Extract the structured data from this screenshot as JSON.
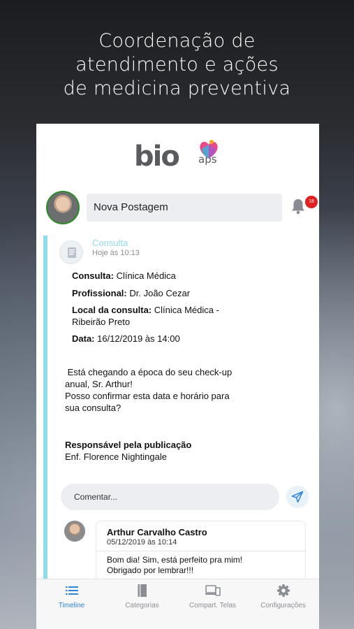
{
  "headline": {
    "line1": "Coordenação de",
    "line2": "atendimento e ações",
    "line3": "de medicina preventiva"
  },
  "app": {
    "logo_text": "bio",
    "logo_sub": "aps",
    "brand_colors": [
      "#e84a8a",
      "#3bb4d8",
      "#f5a623"
    ]
  },
  "compose": {
    "new_post_label": "Nova Postagem",
    "notification_count": "18"
  },
  "post": {
    "type": "Consulta",
    "time": "Hoje às 10:13",
    "accent_color": "#8fdcef",
    "details": [
      {
        "label": "Consulta:",
        "value": " Clínica Médica"
      },
      {
        "label": "Profissional:",
        "value": " Dr. João Cezar"
      },
      {
        "label": "Local da consulta:",
        "value": " Clínica Médica -"
      },
      {
        "label": "",
        "value": "Ribeirão Preto"
      },
      {
        "label": "Data:",
        "value": " 16/12/2019 às 14:00"
      }
    ],
    "body_line1": " Está chegando a época do seu check-up",
    "body_line2": "anual, Sr. Arthur!",
    "body_line3": "Posso confirmar esta data e horário para",
    "body_line4": "sua consulta?",
    "responsible_title": "Responsável pela publicação",
    "responsible_name": "Enf. Florence Nightingale"
  },
  "comment": {
    "placeholder": "Comentar..."
  },
  "reply": {
    "author": "Arthur Carvalho Castro",
    "date": "05/12/2019 às 10:14",
    "line1": "Bom dia! Sim, está perfeito pra mim!",
    "line2": "Obrigado por lembrar!!!"
  },
  "tabs": [
    {
      "label": "Timeline",
      "icon": "list-icon",
      "active": true
    },
    {
      "label": "Categorias",
      "icon": "book-icon",
      "active": false
    },
    {
      "label": "Compart. Telas",
      "icon": "devices-icon",
      "active": false
    },
    {
      "label": "Configurações",
      "icon": "gear-icon",
      "active": false
    }
  ]
}
